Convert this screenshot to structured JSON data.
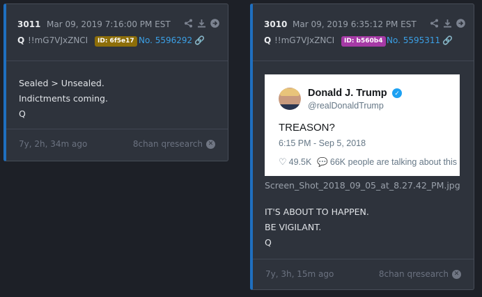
{
  "posts": [
    {
      "number": "3011",
      "date": "Mar 09, 2019 7:16:00 PM EST",
      "author": "Q",
      "tripcode": "!!mG7VJxZNCI",
      "id_badge": "ID: 6f5e17",
      "post_no": "No. 5596292",
      "lines": [
        "Sealed > Unsealed.",
        "Indictments coming.",
        "Q"
      ],
      "age": "7y, 2h, 34m ago",
      "board": "8chan qresearch",
      "badge_color": "#8d6e09"
    },
    {
      "number": "3010",
      "date": "Mar 09, 2019 6:35:12 PM EST",
      "author": "Q",
      "tripcode": "!!mG7VJxZNCI",
      "id_badge": "ID: b560b4",
      "post_no": "No. 5595311",
      "image": {
        "tweet_name": "Donald J. Trump",
        "tweet_handle": "@realDonaldTrump",
        "tweet_text": "TREASON?",
        "tweet_time": "6:15 PM - Sep 5, 2018",
        "tweet_likes": "49.5K",
        "tweet_talking": "66K people are talking about this"
      },
      "filename": "Screen_Shot_2018_09_05_at_8.27.42_PM.jpg",
      "lines": [
        "IT'S ABOUT TO HAPPEN.",
        "BE VIGILANT.",
        "Q"
      ],
      "age": "7y, 3h, 15m ago",
      "board": "8chan qresearch",
      "badge_color": "#a63aa6"
    }
  ],
  "icons": [
    "share-icon",
    "download-icon",
    "arrow-right-circle-icon",
    "link-icon",
    "close-circle-icon",
    "verified-icon",
    "heart-icon",
    "comment-icon"
  ],
  "colors": {
    "accent": "#1f6fbf",
    "link": "#3ba0e6",
    "background": "#1d2027",
    "card": "#2e333c"
  }
}
